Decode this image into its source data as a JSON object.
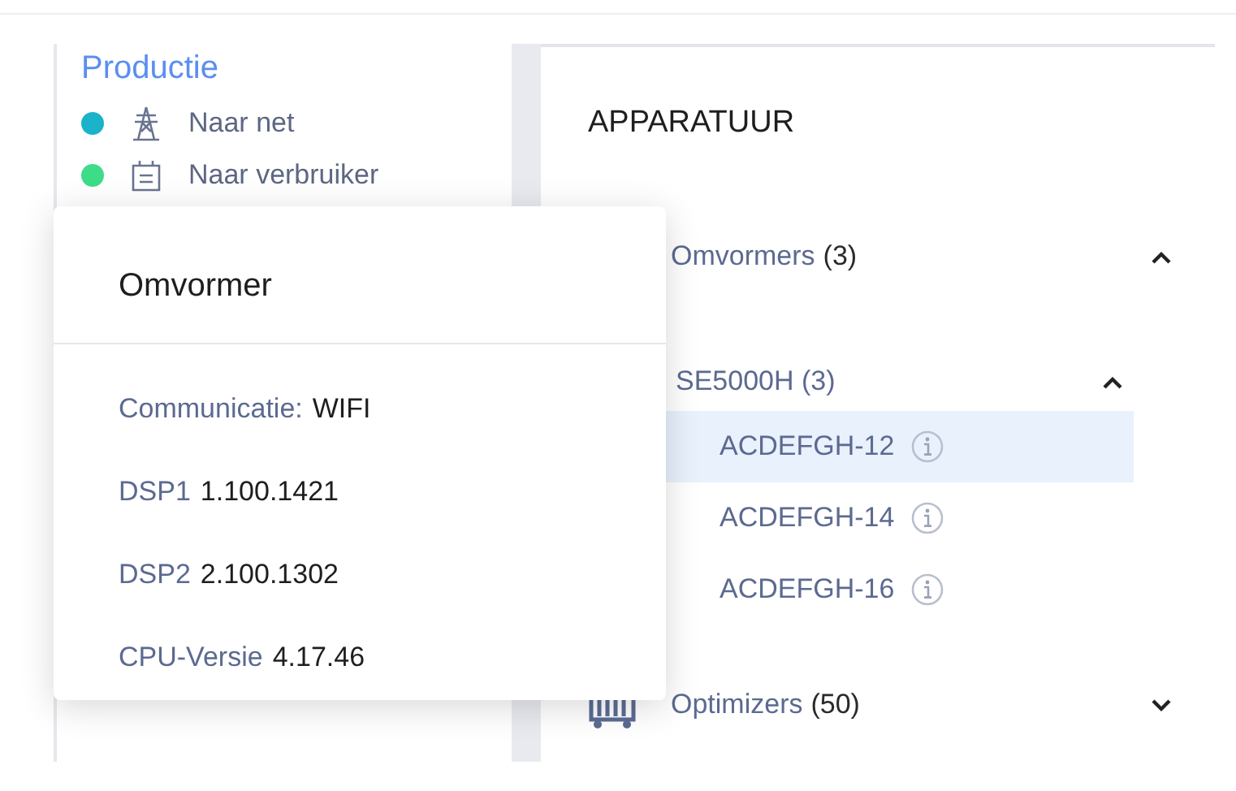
{
  "legend": {
    "title": "Productie",
    "items": [
      {
        "label": "Naar net",
        "color": "#1ab3c9",
        "kind": "pylon"
      },
      {
        "label": "Naar verbruiker",
        "color": "#3ddc86",
        "kind": "meter"
      }
    ]
  },
  "equipment": {
    "title": "APPARATUUR",
    "groups": [
      {
        "label": "Omvormers",
        "count": "(3)",
        "expanded": true,
        "models": [
          {
            "label": "SE5000H (3)",
            "expanded": true,
            "devices": [
              {
                "label": "ACDEFGH-12",
                "selected": true
              },
              {
                "label": "ACDEFGH-14",
                "selected": false
              },
              {
                "label": "ACDEFGH-16",
                "selected": false
              }
            ]
          }
        ]
      },
      {
        "kind": "optimizer",
        "label": "Optimizers",
        "count": "(50)",
        "expanded": false
      }
    ]
  },
  "popup": {
    "title": "Omvormer",
    "rows": [
      {
        "label": "Communicatie:",
        "value": "WIFI"
      },
      {
        "label": "DSP1",
        "value": "1.100.1421"
      },
      {
        "label": "DSP2",
        "value": "2.100.1302"
      },
      {
        "label": "CPU-Versie",
        "value": "4.17.46"
      }
    ]
  }
}
